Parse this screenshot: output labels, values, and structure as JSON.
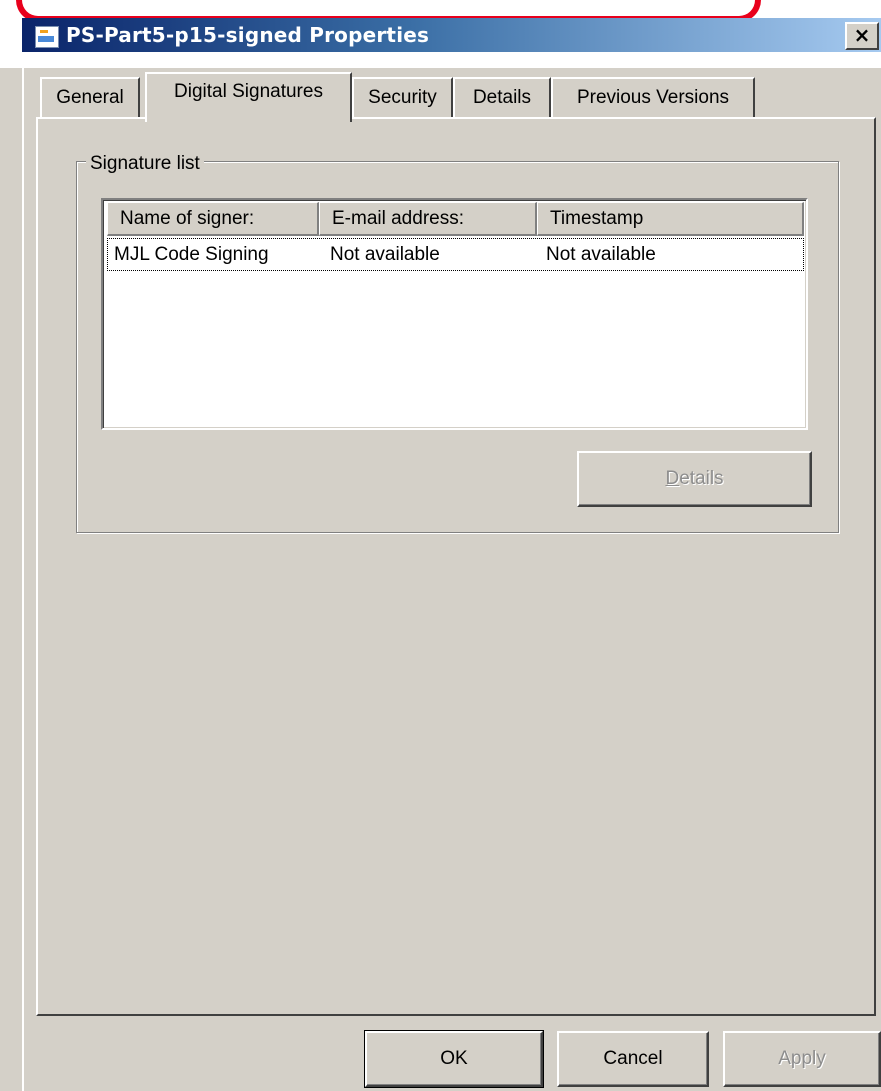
{
  "window": {
    "title": "PS-Part5-p15-signed Properties",
    "close_glyph": "×",
    "icon": "document-icon"
  },
  "tabs": [
    {
      "label": "General",
      "active": false
    },
    {
      "label": "Digital Signatures",
      "active": true
    },
    {
      "label": "Security",
      "active": false
    },
    {
      "label": "Details",
      "active": false
    },
    {
      "label": "Previous Versions",
      "active": false
    }
  ],
  "signature_list": {
    "group_label": "Signature list",
    "columns": [
      "Name of signer:",
      "E-mail address:",
      "Timestamp"
    ],
    "rows": [
      {
        "name": "MJL Code Signing",
        "email": "Not available",
        "timestamp": "Not available"
      }
    ],
    "details_button": {
      "label_access_key": "D",
      "label_rest": "etails",
      "enabled": false
    }
  },
  "footer": {
    "ok_label": "OK",
    "cancel_label": "Cancel",
    "apply_label": "Apply",
    "apply_enabled": false
  },
  "colors": {
    "accent_callout": "#e8001c",
    "titlebar_start": "#0a246a",
    "face": "#d4d0c8"
  }
}
